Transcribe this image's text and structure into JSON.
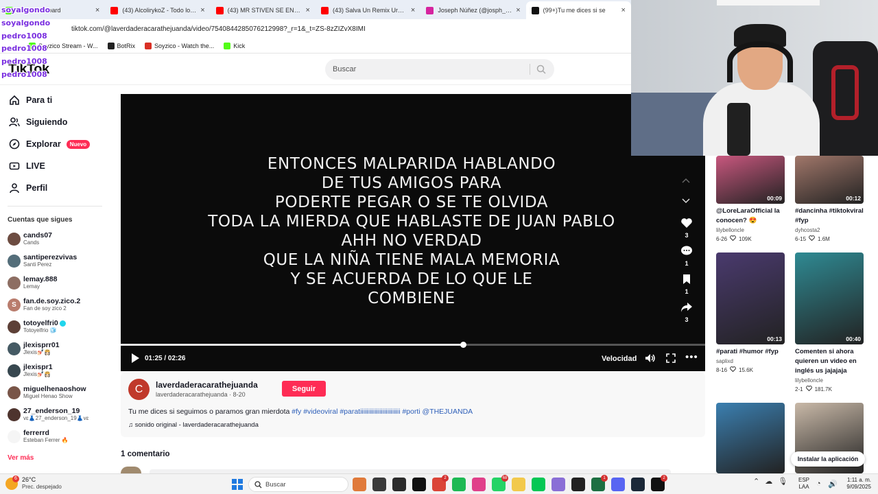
{
  "browser": {
    "tabs": [
      {
        "label": "Kick Dashboard",
        "color": "#53fc18"
      },
      {
        "label": "(43) AlcolirykoZ - Todo lo Bueno",
        "color": "#ff0000"
      },
      {
        "label": "(43) MR STIVEN SE ENCUENTRA",
        "color": "#ff0000"
      },
      {
        "label": "(43) Salva Un Remix Urbano | g",
        "color": "#ff0000"
      },
      {
        "label": "Joseph Núñez (@josph_032) • I",
        "color": "#d6249f"
      },
      {
        "label": "(99+)Tu me dices si se",
        "color": "#111111"
      }
    ],
    "url": "tiktok.com/@laverdaderacarathejuanda/video/7540844285076212998?_r=1&_t=ZS-8zZIZvX8IMI",
    "bookmarks": [
      {
        "label": "Soyzico Stream - W...",
        "color": "#53fc18"
      },
      {
        "label": "BotRix",
        "color": "#222222"
      },
      {
        "label": "Soyzico - Watch the...",
        "color": "#d93025"
      },
      {
        "label": "Kick",
        "color": "#53fc18"
      }
    ]
  },
  "chat_overlay": [
    "soyalgondo",
    "soyalgondo",
    "pedro1008",
    "pedro1008",
    "pedro1008",
    "pedro1008"
  ],
  "tiktok": {
    "logo": "TikTok",
    "search_placeholder": "Buscar",
    "nav": [
      {
        "label": "Para ti",
        "icon": "home-icon"
      },
      {
        "label": "Siguiendo",
        "icon": "people-icon"
      },
      {
        "label": "Explorar",
        "icon": "compass-icon",
        "badge": "Nuevo"
      },
      {
        "label": "LIVE",
        "icon": "live-icon"
      },
      {
        "label": "Perfil",
        "icon": "person-icon"
      }
    ],
    "following_title": "Cuentas que sigues",
    "following": [
      {
        "name": "cands07",
        "sub": "Cands",
        "color": "#6d4c41"
      },
      {
        "name": "santiperezvivas",
        "sub": "Santi Perez",
        "color": "#546e7a"
      },
      {
        "name": "lemay.888",
        "sub": "Lemay",
        "color": "#8d6e63"
      },
      {
        "name": "fan.de.soy.zico.2",
        "sub": "Fan de soy zico 2",
        "color": "#b97c6d",
        "initial": "S"
      },
      {
        "name": "totoyelfri0",
        "sub": "Totoyelfrio 🧊",
        "color": "#5d4037",
        "verified": true
      },
      {
        "name": "jlexisprr01",
        "sub": "Jlexis💅🏻👸🏻",
        "color": "#455a64"
      },
      {
        "name": "jlexispr1",
        "sub": "Jlexis💅🏻👸🏻",
        "color": "#37474f"
      },
      {
        "name": "miguelhenaoshow",
        "sub": "Miguel Henao Show",
        "color": "#795548"
      },
      {
        "name": "27_enderson_19",
        "sub": "vɛ👗27_enderson_19👗vɛ",
        "color": "#4e342e"
      },
      {
        "name": "ferrerrd",
        "sub": "Esteban Ferrer 🔥",
        "color": "#f5f5f5"
      }
    ],
    "see_more": "Ver más"
  },
  "video": {
    "caption_lines": [
      "ENTONCES MALPARIDA HABLANDO",
      "DE TUS AMIGOS PARA",
      "PODERTE PEGAR O SE TE OLVIDA",
      "TODA LA MIERDA QUE HABLASTE DE JUAN PABLO",
      "AHH NO VERDAD",
      "QUE LA NIÑA TIENE MALA MEMORIA",
      "Y SE ACUERDA DE LO QUE LE",
      "COMBIENE"
    ],
    "time": "01:25 / 02:26",
    "progress": 0.5856,
    "speed_label": "Velocidad",
    "likes": "3",
    "comments": "1",
    "saves": "1",
    "shares": "3"
  },
  "author": {
    "initial": "C",
    "name": "laverdaderacarathejuanda",
    "sub": "laverdaderacarathejuanda · 8-20",
    "follow_label": "Seguir",
    "desc_text": "Tu me dices si seguimos o paramos gran mierdota ",
    "desc_tags": "#fy #videoviral #paratiiiiiiiiiiiiiiiiiiiiiiiii #porti @THEJUANDA",
    "sound": "sonido original - laverdaderacarathejuanda"
  },
  "comments_title": "1 comentario",
  "related": [
    {
      "title": "@LoreLaraOfficial la conocen? 😍",
      "user": "lilybelloncle",
      "date": "6-26",
      "likes": "109K",
      "duration": "00:09",
      "thumb": "#c8577e"
    },
    {
      "title": "#dancinha #tiktokviral #fyp",
      "user": "dyhcosta2",
      "date": "6-15",
      "likes": "1.6M",
      "duration": "00:12",
      "thumb": "#a1776a"
    },
    {
      "title": "#parati #humor #fyp",
      "user": "saplixd",
      "date": "8-16",
      "likes": "15.6K",
      "duration": "00:13",
      "thumb": "#4a3a6e"
    },
    {
      "title": "Comenten si ahora quieren un video en inglés us jajajaja",
      "user": "lilybelloncle",
      "date": "2-1",
      "likes": "181.7K",
      "duration": "00:40",
      "thumb": "#2f8a93"
    },
    {
      "title": "",
      "user": "",
      "date": "",
      "likes": "",
      "duration": "",
      "thumb": "#3b7fb0"
    },
    {
      "title": "",
      "user": "",
      "date": "",
      "likes": "",
      "duration": "",
      "thumb": "#c9b9a8"
    }
  ],
  "install_label": "Instalar la aplicación",
  "taskbar": {
    "temp": "26°C",
    "weather": "Prec. despejado",
    "weather_badge": "6",
    "search_placeholder": "Buscar",
    "lang1": "ESP",
    "lang2": "LAA",
    "time": "1:11 a. m.",
    "date": "9/09/2025",
    "apps": [
      {
        "name": "fish-app-icon",
        "color": "#e07a3b"
      },
      {
        "name": "taskview-icon",
        "color": "#3a3a3a"
      },
      {
        "name": "obs-icon",
        "color": "#2b2b2b",
        "badge": ""
      },
      {
        "name": "tiktok-app-icon",
        "color": "#111111"
      },
      {
        "name": "chrome-icon",
        "color": "#db4437",
        "badge": "2"
      },
      {
        "name": "spotify-icon",
        "color": "#1db954"
      },
      {
        "name": "t-app-icon",
        "color": "#e0408a"
      },
      {
        "name": "whatsapp-icon",
        "color": "#25d366",
        "badge": "68"
      },
      {
        "name": "files-icon",
        "color": "#f2c94c"
      },
      {
        "name": "line-icon",
        "color": "#06c755"
      },
      {
        "name": "game-icon",
        "color": "#8a6fd6"
      },
      {
        "name": "capcut-icon",
        "color": "#222222"
      },
      {
        "name": "excel-icon",
        "color": "#1d6f42",
        "badge": "1"
      },
      {
        "name": "discord-icon",
        "color": "#5865f2"
      },
      {
        "name": "steam-icon",
        "color": "#1b2838"
      },
      {
        "name": "tiktok-live-icon",
        "color": "#111111",
        "badge": "2"
      }
    ]
  }
}
